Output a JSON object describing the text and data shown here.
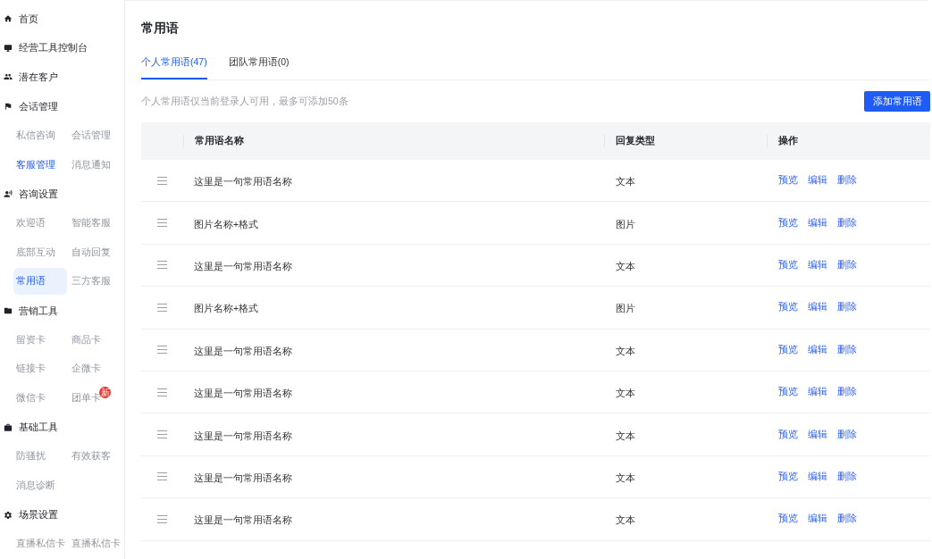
{
  "sidebar": {
    "groups": [
      {
        "label": "首页"
      },
      {
        "label": "经营工具控制台"
      },
      {
        "label": "潜在客户"
      },
      {
        "label": "会话管理",
        "items": [
          {
            "label": "私信咨询",
            "selected": false,
            "highlighted": false
          },
          {
            "label": "会话管理",
            "selected": false,
            "highlighted": false
          },
          {
            "label": "客服管理",
            "selected": false,
            "highlighted": true
          },
          {
            "label": "消息通知",
            "selected": false,
            "highlighted": false
          }
        ]
      },
      {
        "label": "咨询设置",
        "items": [
          {
            "label": "欢迎语",
            "selected": false,
            "highlighted": false
          },
          {
            "label": "智能客服",
            "selected": false,
            "highlighted": false
          },
          {
            "label": "底部互动",
            "selected": false,
            "highlighted": false
          },
          {
            "label": "自动回复",
            "selected": false,
            "highlighted": false
          },
          {
            "label": "常用语",
            "selected": true,
            "highlighted": true
          },
          {
            "label": "三方客服",
            "selected": false,
            "highlighted": false
          }
        ]
      },
      {
        "label": "营销工具",
        "items": [
          {
            "label": "留资卡",
            "selected": false,
            "highlighted": false
          },
          {
            "label": "商品卡",
            "selected": false,
            "highlighted": false
          },
          {
            "label": "链接卡",
            "selected": false,
            "highlighted": false
          },
          {
            "label": "企微卡",
            "selected": false,
            "highlighted": false
          },
          {
            "label": "微信卡",
            "selected": false,
            "highlighted": false
          },
          {
            "label": "团单卡",
            "selected": false,
            "highlighted": false,
            "badge": "新"
          }
        ]
      },
      {
        "label": "基础工具",
        "items": [
          {
            "label": "防骚扰",
            "selected": false,
            "highlighted": false
          },
          {
            "label": "有效获客",
            "selected": false,
            "highlighted": false
          },
          {
            "label": "消息诊断",
            "selected": false,
            "highlighted": false
          }
        ]
      },
      {
        "label": "场景设置",
        "items": [
          {
            "label": "直播私信卡",
            "selected": false,
            "highlighted": false
          },
          {
            "label": "直播私信卡",
            "selected": false,
            "highlighted": false
          }
        ]
      }
    ]
  },
  "page": {
    "title": "常用语"
  },
  "tabs": [
    {
      "label": "个人常用语(47)",
      "selected": true
    },
    {
      "label": "团队常用语(0)",
      "selected": false
    }
  ],
  "notice": "个人常用语仅当前登录人可用，最多可添加50条",
  "add_button": "添加常用语",
  "table": {
    "columns": [
      "常用语名称",
      "回复类型",
      "操作"
    ],
    "rows": [
      {
        "name": "这里是一句常用语名称",
        "type": "文本",
        "actions": [
          "预览",
          "编辑",
          "删除"
        ]
      },
      {
        "name": "图片名称+格式",
        "type": "图片",
        "actions": [
          "预览",
          "编辑",
          "删除"
        ]
      },
      {
        "name": "这里是一句常用语名称",
        "type": "文本",
        "actions": [
          "预览",
          "编辑",
          "删除"
        ]
      },
      {
        "name": "图片名称+格式",
        "type": "图片",
        "actions": [
          "预览",
          "编辑",
          "删除"
        ]
      },
      {
        "name": "这里是一句常用语名称",
        "type": "文本",
        "actions": [
          "预览",
          "编辑",
          "删除"
        ]
      },
      {
        "name": "这里是一句常用语名称",
        "type": "文本",
        "actions": [
          "预览",
          "编辑",
          "删除"
        ]
      },
      {
        "name": "这里是一句常用语名称",
        "type": "文本",
        "actions": [
          "预览",
          "编辑",
          "删除"
        ]
      },
      {
        "name": "这里是一句常用语名称",
        "type": "文本",
        "actions": [
          "预览",
          "编辑",
          "删除"
        ]
      },
      {
        "name": "这里是一句常用语名称",
        "type": "文本",
        "actions": [
          "预览",
          "编辑",
          "删除"
        ]
      }
    ]
  }
}
